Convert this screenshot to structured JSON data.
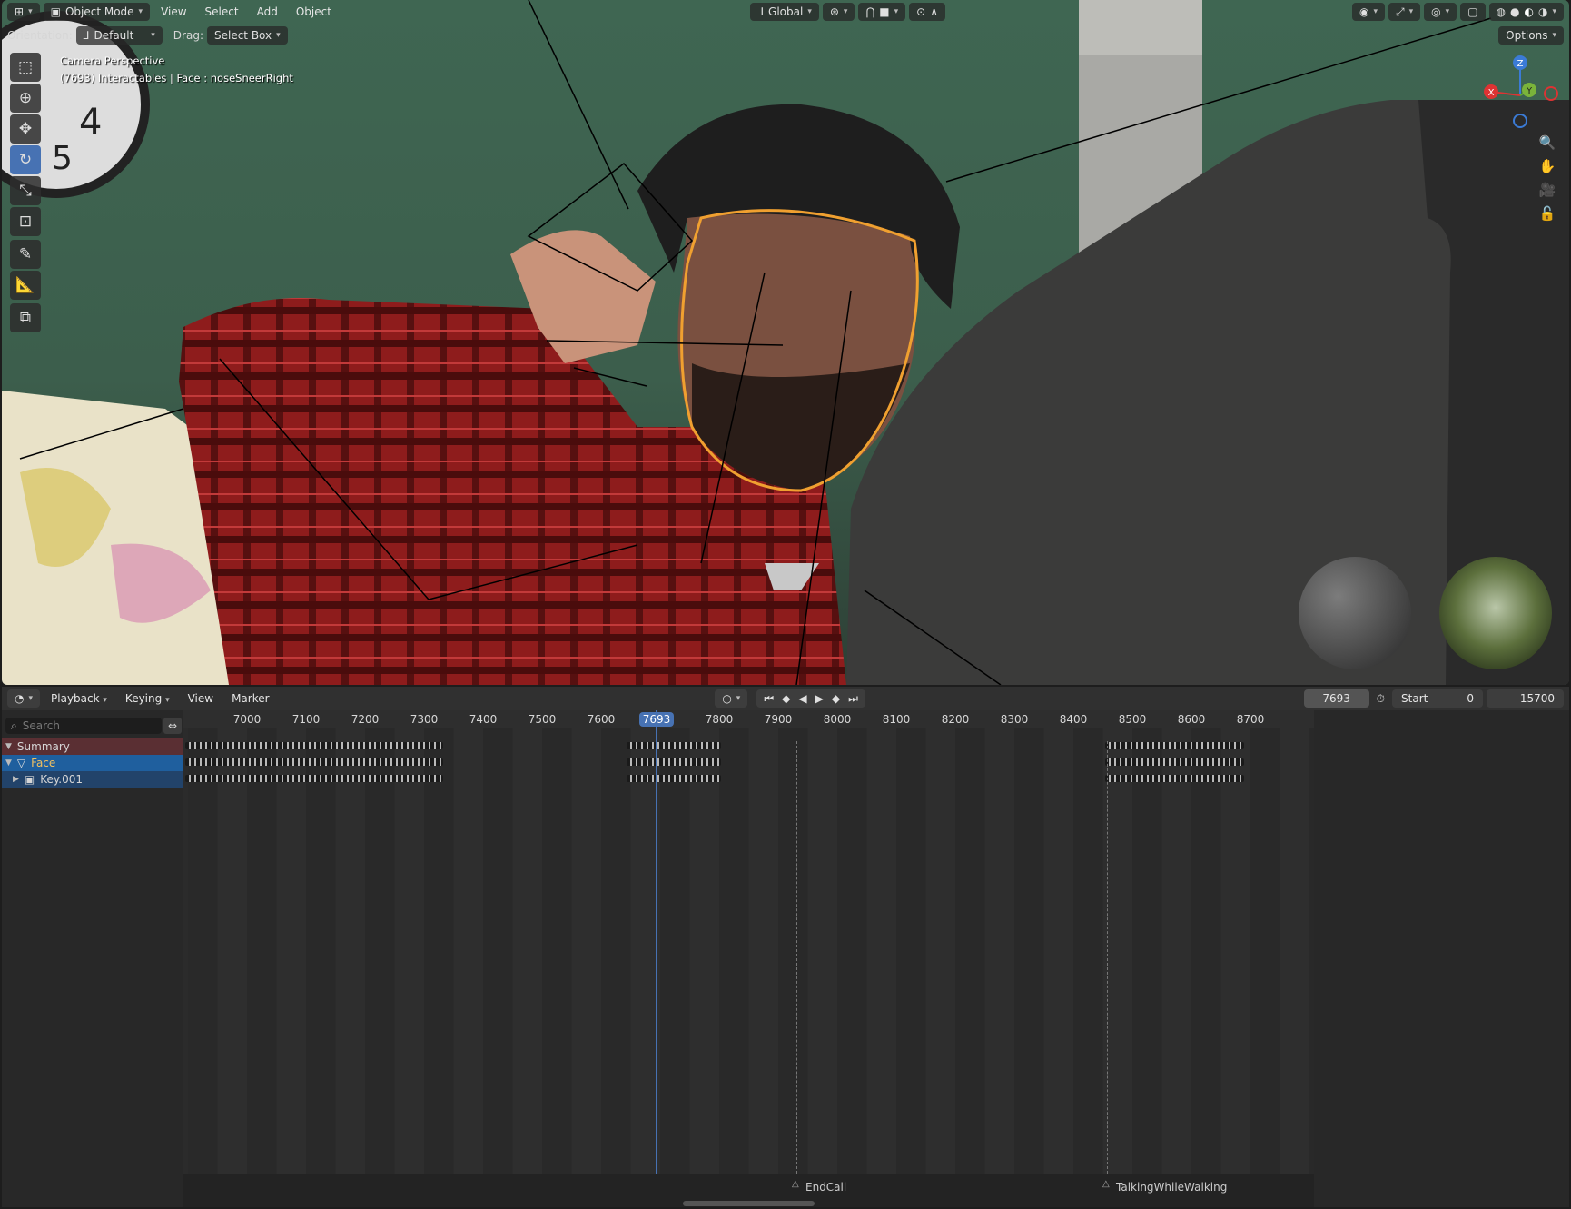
{
  "viewport_header": {
    "mode": "Object Mode",
    "menus": [
      "View",
      "Select",
      "Add",
      "Object"
    ],
    "transform_orientation": "Global",
    "options": "Options"
  },
  "tool_header": {
    "orientation_label": "Orientation:",
    "orientation_value": "Default",
    "drag_label": "Drag:",
    "drag_value": "Select Box"
  },
  "overlay": {
    "line1": "Camera Perspective",
    "line2": "(7693) Interactables | Face : noseSneerRight"
  },
  "gizmo": {
    "x": "X",
    "y": "Y",
    "z": "Z"
  },
  "toolbar_icons": [
    "select-box-icon",
    "cursor-icon",
    "move-icon",
    "rotate-icon",
    "scale-icon",
    "transform-icon",
    "annotate-icon",
    "measure-icon",
    "add-cube-icon"
  ],
  "timeline_header": {
    "menus": [
      "Playback",
      "Keying",
      "View",
      "Marker"
    ],
    "current_frame": "7693",
    "start_label": "Start",
    "start_value": "0",
    "end_value": "15700"
  },
  "search": {
    "placeholder": "Search"
  },
  "channels": [
    {
      "label": "Summary"
    },
    {
      "label": "Face"
    },
    {
      "label": "Key.001"
    }
  ],
  "ruler": [
    "7000",
    "7100",
    "7200",
    "7300",
    "7400",
    "7500",
    "7600",
    "7800",
    "7900",
    "8000",
    "8100",
    "8200",
    "8300",
    "8400",
    "8500",
    "8600",
    "8700"
  ],
  "playhead_label": "7693",
  "markers": [
    "EndCall",
    "TalkingWhileWalking"
  ],
  "colors": {
    "accent": "#4772b3",
    "selection_outline": "#f0a030",
    "summary_bg": "#5a2f33",
    "face_bg": "#1f5f9e"
  }
}
